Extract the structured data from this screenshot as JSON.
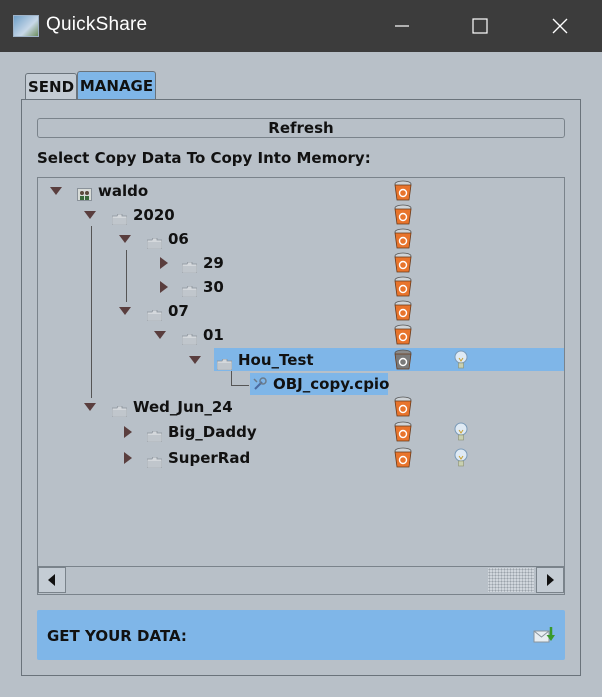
{
  "window": {
    "title": "QuickShare"
  },
  "tabs": [
    {
      "label": "SEND",
      "active": false
    },
    {
      "label": "MANAGE",
      "active": true
    }
  ],
  "manage": {
    "refresh_label": "Refresh",
    "prompt": "Select Copy Data To Copy Into Memory:",
    "tree": [
      {
        "label": "waldo",
        "icon": "user-folder-icon",
        "expanded": true
      },
      {
        "label": "2020",
        "icon": "folder-icon",
        "expanded": true
      },
      {
        "label": "06",
        "icon": "folder-icon",
        "expanded": true
      },
      {
        "label": "29",
        "icon": "folder-icon",
        "expanded": false
      },
      {
        "label": "30",
        "icon": "folder-icon",
        "expanded": false
      },
      {
        "label": "07",
        "icon": "folder-icon",
        "expanded": true
      },
      {
        "label": "01",
        "icon": "folder-icon",
        "expanded": true
      },
      {
        "label": "Hou_Test",
        "icon": "folder-icon",
        "expanded": true,
        "selected": true,
        "has_bulb": true
      },
      {
        "label": "OBJ_copy.cpio",
        "icon": "tool-icon",
        "selected": true
      },
      {
        "label": "Wed_Jun_24",
        "icon": "folder-icon",
        "expanded": true
      },
      {
        "label": "Big_Daddy",
        "icon": "folder-icon",
        "expanded": false,
        "has_bulb": true
      },
      {
        "label": "SuperRad",
        "icon": "folder-icon",
        "expanded": false,
        "has_bulb": true
      }
    ],
    "footer_label": "GET YOUR DATA:"
  },
  "colors": {
    "accent": "#7fb6e8",
    "background": "#b8c0c8",
    "titlebar": "#3c3c3c",
    "bucket": "#e8742c"
  }
}
